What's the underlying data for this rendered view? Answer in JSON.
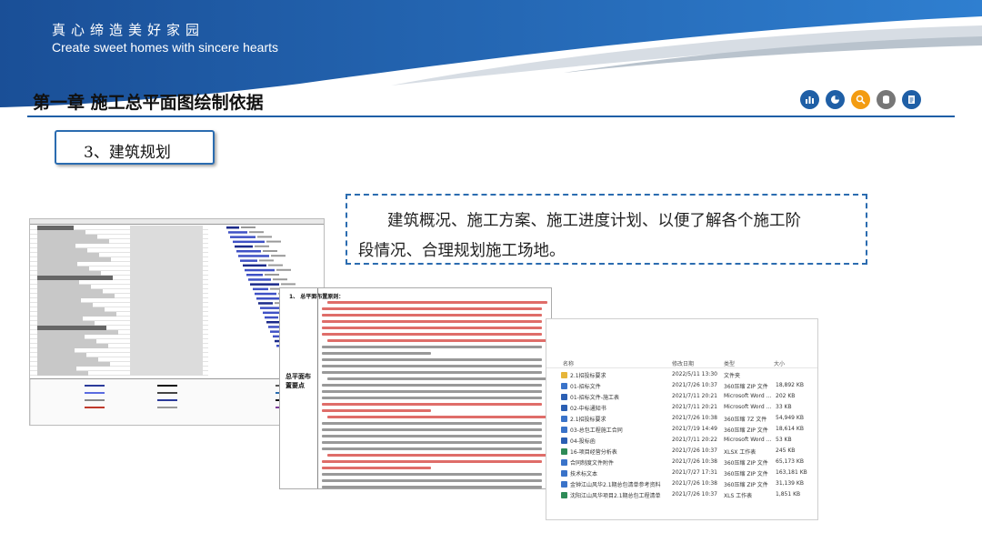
{
  "header": {
    "slogan_cn": "真心缔造美好家园",
    "slogan_en": "Create sweet homes with sincere hearts",
    "chapter_title": "第一章  施工总平面图绘制依据",
    "brand_color": "#1c5ea8"
  },
  "toolbar": {
    "icons": [
      "bar-chart-icon",
      "pie-chart-icon",
      "search-icon",
      "database-icon",
      "document-icon"
    ]
  },
  "section_tab": {
    "label": "3、建筑规划"
  },
  "description": {
    "line1": "建筑概况、施工方案、施工进度计划、以便了解各个施工阶",
    "line2": "段情况、合理规划施工场地。"
  },
  "document": {
    "heading": "1、    总平面布置原则：",
    "side_label": "总平面布置要点"
  },
  "file_list": {
    "columns": [
      "名称",
      "修改日期",
      "类型",
      "大小"
    ],
    "rows": [
      {
        "name": "2.1招投标要求",
        "date": "2022/5/11 13:30",
        "type": "文件夹",
        "size": ""
      },
      {
        "name": "01-招标文件",
        "date": "2021/7/26 10:37",
        "type": "360压缩 ZIP 文件",
        "size": "18,892 KB"
      },
      {
        "name": "01-招标文件-施工表",
        "date": "2021/7/11 20:21",
        "type": "Microsoft Word ...",
        "size": "202 KB"
      },
      {
        "name": "02-中标通知书",
        "date": "2021/7/11 20:21",
        "type": "Microsoft Word ...",
        "size": "33 KB"
      },
      {
        "name": "2.1招投标要求",
        "date": "2021/7/26 10:38",
        "type": "360压缩 7Z 文件",
        "size": "54,949 KB"
      },
      {
        "name": "03-总包工程施工合同",
        "date": "2021/7/19 14:49",
        "type": "360压缩 ZIP 文件",
        "size": "18,614 KB"
      },
      {
        "name": "04-投标函",
        "date": "2021/7/11 20:22",
        "type": "Microsoft Word ...",
        "size": "53 KB"
      },
      {
        "name": "16-项目经营分析表",
        "date": "2021/7/26 10:37",
        "type": "XLSX 工作表",
        "size": "245 KB"
      },
      {
        "name": "合同制度文件附件",
        "date": "2021/7/26 10:38",
        "type": "360压缩 ZIP 文件",
        "size": "65,173 KB"
      },
      {
        "name": "技术标文本",
        "date": "2021/7/27 17:31",
        "type": "360压缩 ZIP 文件",
        "size": "163,181 KB"
      },
      {
        "name": "金钟江山风华2.1期总包清单参考资料",
        "date": "2021/7/26 10:38",
        "type": "360压缩 ZIP 文件",
        "size": "31,139 KB"
      },
      {
        "name": "沈阳江山风华项目2.1期总包工程清单",
        "date": "2021/7/26 10:37",
        "type": "XLS 工作表",
        "size": "1,851 KB"
      }
    ]
  }
}
